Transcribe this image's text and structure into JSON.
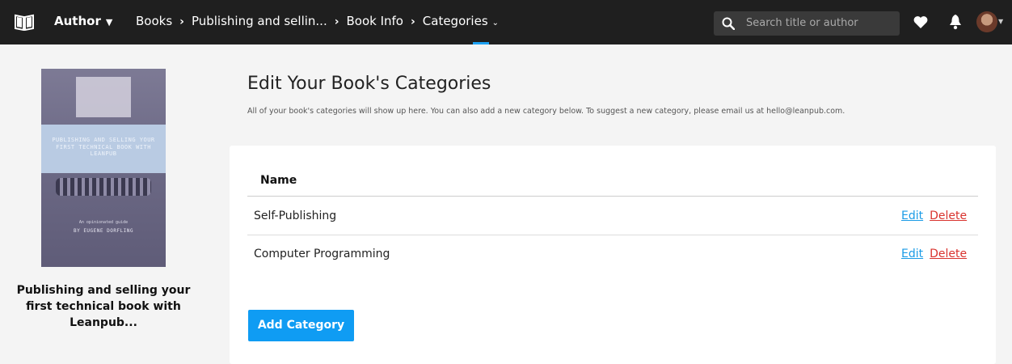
{
  "topbar": {
    "author_label": "Author",
    "breadcrumbs": [
      "Books",
      "Publishing and sellin...",
      "Book Info",
      "Categories"
    ],
    "search_placeholder": "Search title or author",
    "colors": {
      "bar": "#1f1f1f",
      "accent": "#1da1f2"
    }
  },
  "sidebar": {
    "cover": {
      "title": "PUBLISHING AND SELLING YOUR FIRST TECHNICAL BOOK WITH LEANPUB",
      "subtitle": "An opinionated guide",
      "byline": "BY EUGENE DORFLING"
    },
    "book_title": "Publishing and selling your first technical book with Leanpub..."
  },
  "main": {
    "heading": "Edit Your Book's Categories",
    "description": "All of your book's categories will show up here. You can also add a new category below. To suggest a new category, please email us at hello@leanpub.com.",
    "table": {
      "header_name": "Name",
      "rows": [
        {
          "name": "Self-Publishing",
          "edit": "Edit",
          "delete": "Delete"
        },
        {
          "name": "Computer Programming",
          "edit": "Edit",
          "delete": "Delete"
        }
      ]
    },
    "add_button": "Add Category",
    "colors": {
      "link": "#1a9be6",
      "danger": "#d9332e",
      "button": "#0f9cf3"
    }
  },
  "icons": [
    "book-logo-icon",
    "caret-down-icon",
    "chevron-right-icon",
    "search-icon",
    "heart-icon",
    "bell-icon",
    "avatar"
  ]
}
